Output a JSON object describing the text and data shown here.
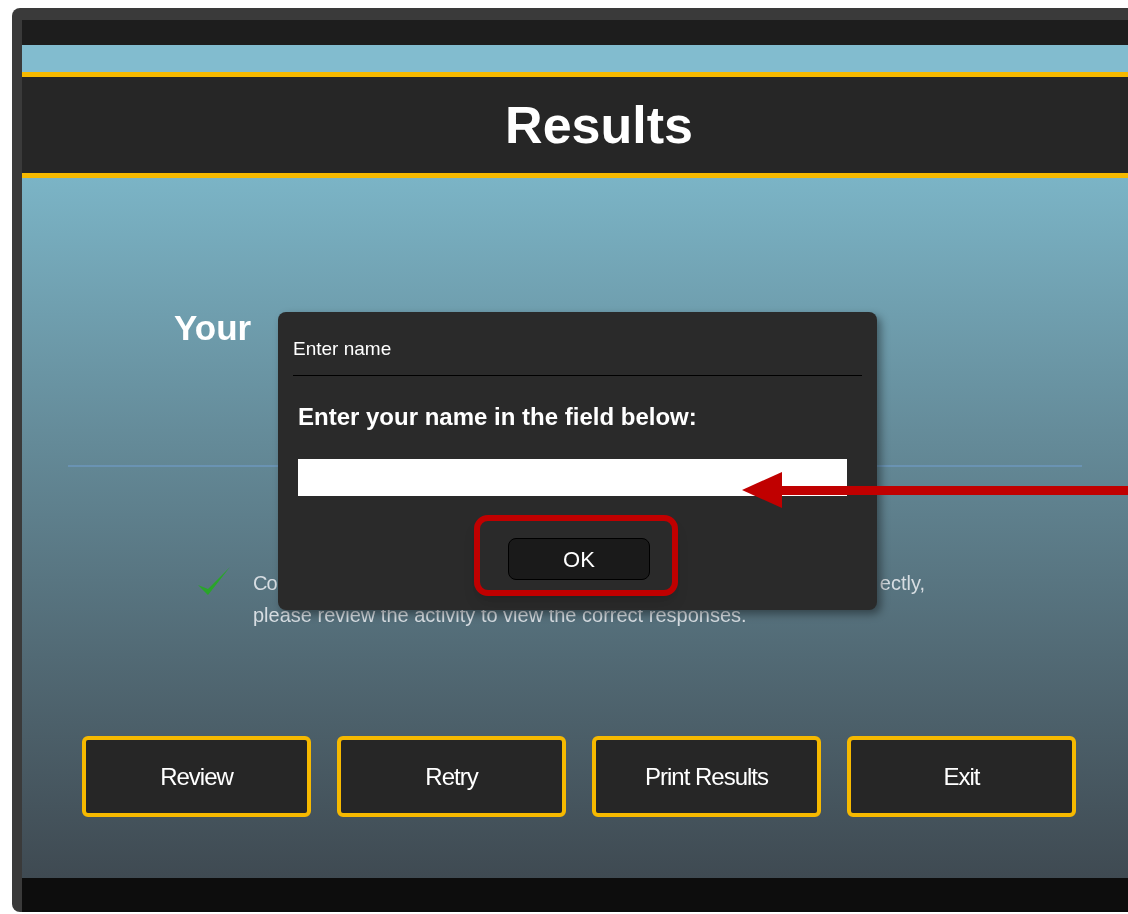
{
  "header": {
    "title": "Results"
  },
  "score": {
    "label": "Your"
  },
  "message": {
    "line_1_left": "Co",
    "line_1_right": "ectly,",
    "line_2": "please review the activity to view the correct responses."
  },
  "buttons": [
    "Review",
    "Retry",
    "Print Results",
    "Exit"
  ],
  "dialog": {
    "title": "Enter name",
    "prompt": "Enter your name in the field below:",
    "ok_button": "OK"
  }
}
